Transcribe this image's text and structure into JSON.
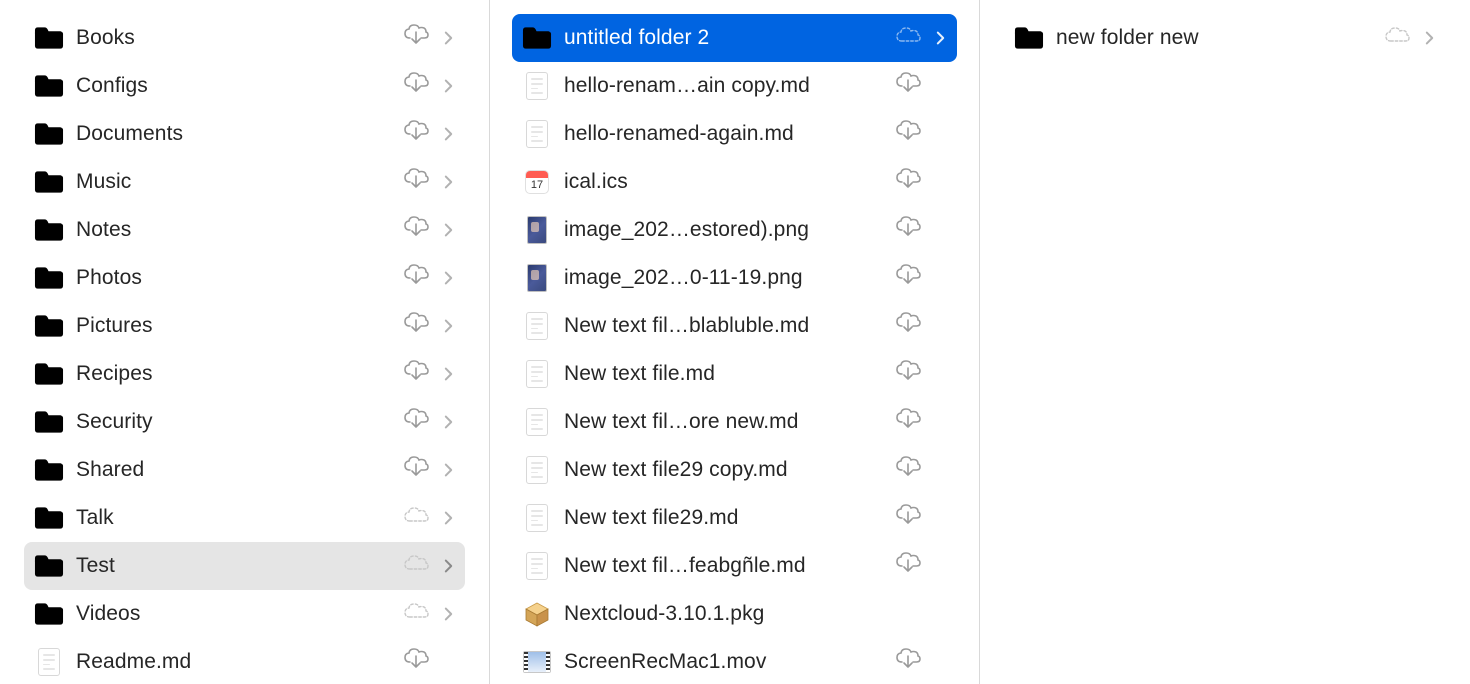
{
  "columns": [
    {
      "id": "col1",
      "items": [
        {
          "name": "Books",
          "type": "folder",
          "status": "cloud-download",
          "hasChildren": true,
          "state": "normal"
        },
        {
          "name": "Configs",
          "type": "folder",
          "status": "cloud-download",
          "hasChildren": true,
          "state": "normal"
        },
        {
          "name": "Documents",
          "type": "folder",
          "status": "cloud-download",
          "hasChildren": true,
          "state": "normal"
        },
        {
          "name": "Music",
          "type": "folder",
          "status": "cloud-download",
          "hasChildren": true,
          "state": "normal"
        },
        {
          "name": "Notes",
          "type": "folder",
          "status": "cloud-download",
          "hasChildren": true,
          "state": "normal"
        },
        {
          "name": "Photos",
          "type": "folder",
          "status": "cloud-download",
          "hasChildren": true,
          "state": "normal"
        },
        {
          "name": "Pictures",
          "type": "folder",
          "status": "cloud-download",
          "hasChildren": true,
          "state": "normal"
        },
        {
          "name": "Recipes",
          "type": "folder",
          "status": "cloud-download",
          "hasChildren": true,
          "state": "normal"
        },
        {
          "name": "Security",
          "type": "folder",
          "status": "cloud-download",
          "hasChildren": true,
          "state": "normal"
        },
        {
          "name": "Shared",
          "type": "folder",
          "status": "cloud-download",
          "hasChildren": true,
          "state": "normal"
        },
        {
          "name": "Talk",
          "type": "folder",
          "status": "cloud-outline",
          "hasChildren": true,
          "state": "normal"
        },
        {
          "name": "Test",
          "type": "folder",
          "status": "cloud-outline",
          "hasChildren": true,
          "state": "active-path"
        },
        {
          "name": "Videos",
          "type": "folder",
          "status": "cloud-outline",
          "hasChildren": true,
          "state": "normal"
        },
        {
          "name": "Readme.md",
          "type": "document",
          "status": "cloud-download",
          "hasChildren": false,
          "state": "normal"
        }
      ]
    },
    {
      "id": "col2",
      "items": [
        {
          "name": "untitled folder 2",
          "type": "folder",
          "status": "cloud-outline",
          "hasChildren": true,
          "state": "selected"
        },
        {
          "name": "hello-renam…ain copy.md",
          "type": "document",
          "status": "cloud-download",
          "hasChildren": false,
          "state": "normal"
        },
        {
          "name": "hello-renamed-again.md",
          "type": "document",
          "status": "cloud-download",
          "hasChildren": false,
          "state": "normal"
        },
        {
          "name": "ical.ics",
          "type": "calendar",
          "status": "cloud-download",
          "hasChildren": false,
          "state": "normal"
        },
        {
          "name": "image_202…estored).png",
          "type": "image",
          "status": "cloud-download",
          "hasChildren": false,
          "state": "normal"
        },
        {
          "name": "image_202…0-11-19.png",
          "type": "image",
          "status": "cloud-download",
          "hasChildren": false,
          "state": "normal"
        },
        {
          "name": "New text fil…blabluble.md",
          "type": "document",
          "status": "cloud-download",
          "hasChildren": false,
          "state": "normal"
        },
        {
          "name": "New text file.md",
          "type": "document",
          "status": "cloud-download",
          "hasChildren": false,
          "state": "normal"
        },
        {
          "name": "New text fil…ore new.md",
          "type": "document",
          "status": "cloud-download",
          "hasChildren": false,
          "state": "normal"
        },
        {
          "name": "New text file29 copy.md",
          "type": "document",
          "status": "cloud-download",
          "hasChildren": false,
          "state": "normal"
        },
        {
          "name": "New text file29.md",
          "type": "document",
          "status": "cloud-download",
          "hasChildren": false,
          "state": "normal"
        },
        {
          "name": "New text fil…feabgñle.md",
          "type": "document",
          "status": "cloud-download",
          "hasChildren": false,
          "state": "normal"
        },
        {
          "name": "Nextcloud-3.10.1.pkg",
          "type": "package",
          "status": "none",
          "hasChildren": false,
          "state": "normal"
        },
        {
          "name": "ScreenRecMac1.mov",
          "type": "movie",
          "status": "cloud-download",
          "hasChildren": false,
          "state": "normal"
        }
      ]
    },
    {
      "id": "col3",
      "items": [
        {
          "name": "new folder new",
          "type": "folder",
          "status": "cloud-outline",
          "hasChildren": true,
          "state": "normal"
        }
      ]
    }
  ],
  "icons": {
    "calendar_day": "17"
  }
}
